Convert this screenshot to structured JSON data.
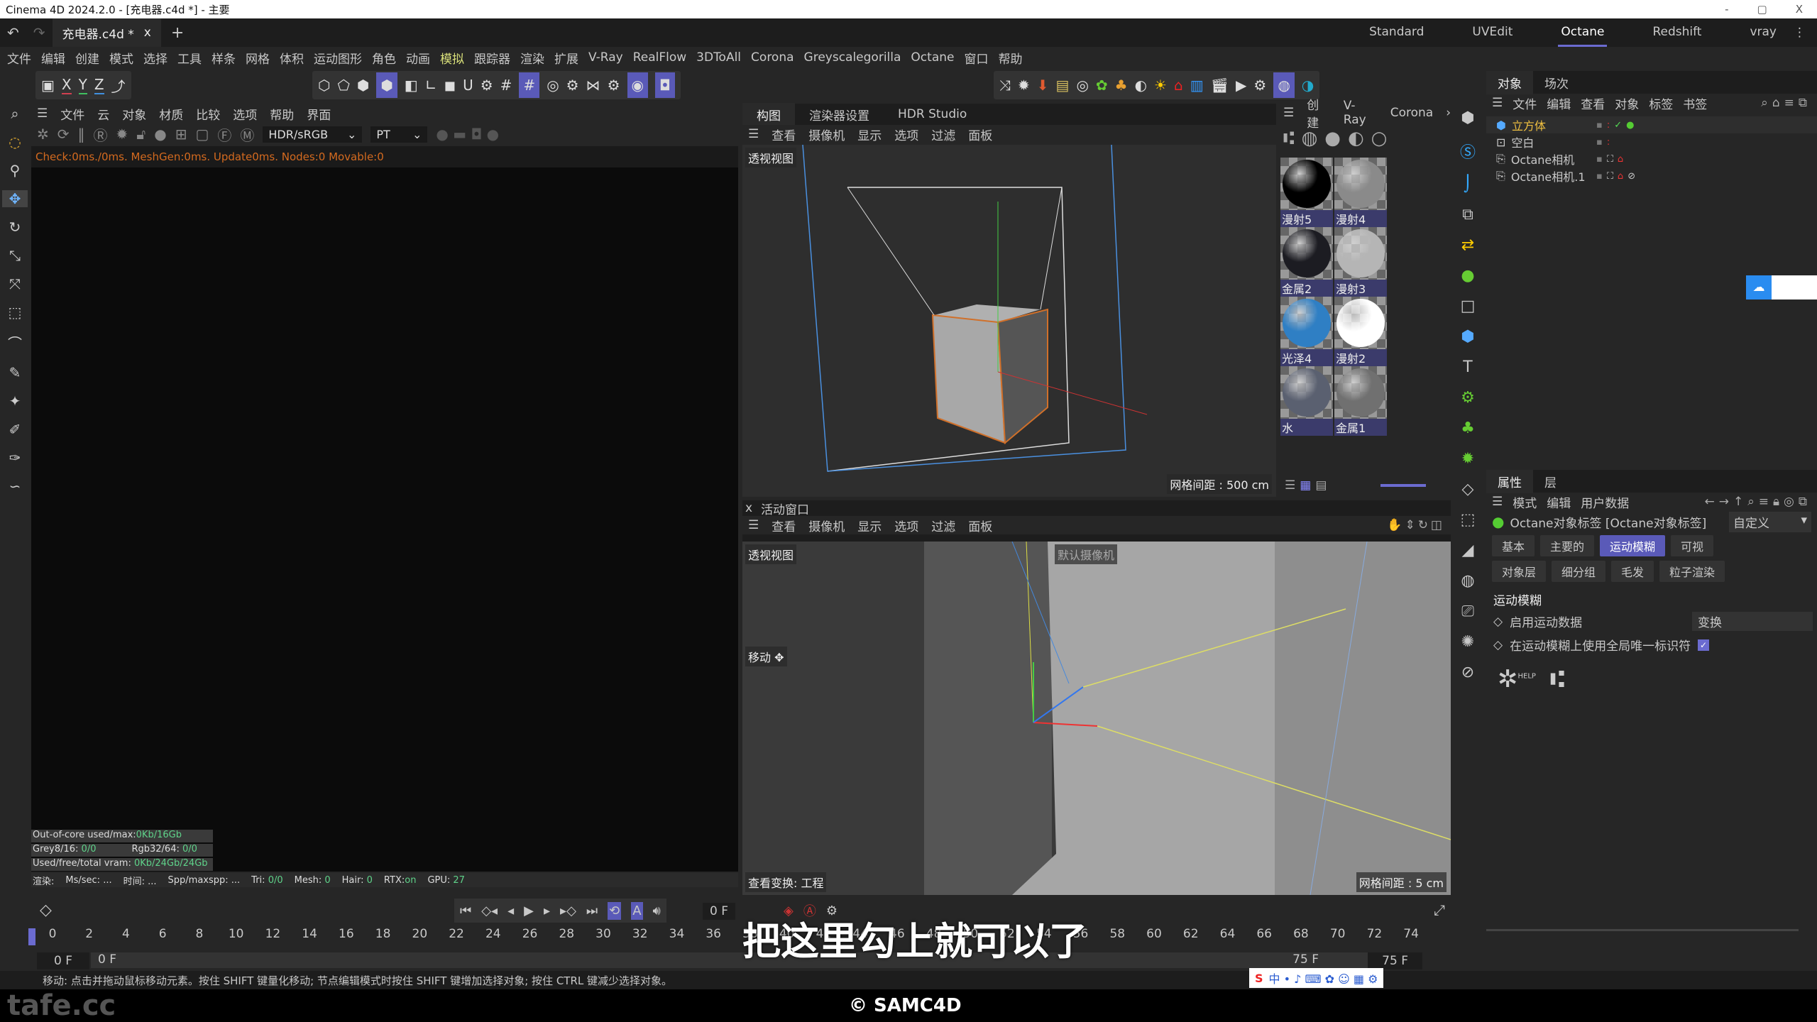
{
  "window": {
    "title": "Cinema 4D 2024.2.0 - [充电器.c4d *] - 主要",
    "min": "-",
    "max": "▢",
    "close": "X"
  },
  "tabs": {
    "doc": "充电器.c4d *",
    "close": "x",
    "add": "+",
    "layouts": [
      "Standard",
      "UVEdit",
      "Octane",
      "Redshift",
      "vray"
    ],
    "active_layout": "Octane"
  },
  "menu": [
    "文件",
    "编辑",
    "创建",
    "模式",
    "选择",
    "工具",
    "样条",
    "网格",
    "体积",
    "运动图形",
    "角色",
    "动画",
    "模拟",
    "跟踪器",
    "渲染",
    "扩展",
    "V-Ray",
    "RealFlow",
    "3DToAll",
    "Corona",
    "Greyscalegorilla",
    "Octane",
    "窗口",
    "帮助"
  ],
  "axes": {
    "x": "X",
    "y": "Y",
    "z": "Z"
  },
  "live": {
    "menu": [
      "文件",
      "云",
      "对象",
      "材质",
      "比较",
      "选项",
      "帮助",
      "界面"
    ],
    "colorspace": "HDR/sRGB",
    "kernel": "PT",
    "check": "Check:0ms./0ms. MeshGen:0ms. Update0ms. Nodes:0 Movable:0",
    "stats": {
      "ooc_label": "Out-of-core used/max:",
      "ooc": "0Kb/16Gb",
      "grey_label": "Grey8/16:",
      "grey": "0/0",
      "rgb_label": "Rgb32/64:",
      "rgb": "0/0",
      "vram_label": "Used/free/total vram:",
      "vram": "0Kb/24Gb/24Gb"
    },
    "render": {
      "label": "渲染:",
      "mssec": "Ms/sec: ...",
      "time": "时间: ...",
      "spp": "Spp/maxspp: ...",
      "tri_label": "Tri:",
      "tri": "0/0",
      "mesh_label": "Mesh:",
      "mesh": "0",
      "hair_label": "Hair:",
      "hair": "0",
      "rtx_label": "RTX:",
      "rtx": "on",
      "gpu_label": "GPU:",
      "gpu": "27"
    }
  },
  "viewport_top": {
    "tabs": [
      "构图",
      "渲染器设置",
      "HDR Studio"
    ],
    "menu": [
      "查看",
      "摄像机",
      "显示",
      "选项",
      "过滤",
      "面板"
    ],
    "label": "透视视图",
    "grid": "网格间距 : 500 cm"
  },
  "viewport_bottom": {
    "title": "活动窗口",
    "close": "x",
    "menu": [
      "查看",
      "摄像机",
      "显示",
      "选项",
      "过滤",
      "面板"
    ],
    "label": "透视视图",
    "camera": "默认摄像机",
    "tool": "移动",
    "transform": "查看变换: 工程",
    "grid": "网格间距 : 5 cm"
  },
  "materials": {
    "menu": [
      "创建",
      "V-Ray",
      "Corona"
    ],
    "items": [
      {
        "name": "漫射5",
        "color": "#000000"
      },
      {
        "name": "漫射4",
        "color": "#8a8a8a"
      },
      {
        "name": "金属2",
        "color": "#1c1c22"
      },
      {
        "name": "漫射3",
        "color": "#b5b5b5"
      },
      {
        "name": "光泽4",
        "color": "#2f7fc4"
      },
      {
        "name": "漫射2",
        "color": "#ffffff"
      },
      {
        "name": "水",
        "color": "#5a6070"
      },
      {
        "name": "金属1",
        "color": "#707070"
      }
    ]
  },
  "objects": {
    "tabs": [
      "对象",
      "场次"
    ],
    "menu": [
      "文件",
      "编辑",
      "查看",
      "对象",
      "标签",
      "书签"
    ],
    "items": [
      {
        "name": "立方体",
        "selected": true
      },
      {
        "name": "空白"
      },
      {
        "name": "Octane相机"
      },
      {
        "name": "Octane相机.1"
      }
    ]
  },
  "attributes": {
    "tabs": [
      "属性",
      "层"
    ],
    "menu": [
      "模式",
      "编辑",
      "用户数据"
    ],
    "title": "Octane对象标签 [Octane对象标签]",
    "preset": "自定义",
    "buttons": [
      "基本",
      "主要的",
      "运动模糊",
      "可视",
      "对象层",
      "细分组",
      "毛发",
      "粒子渲染"
    ],
    "active": "运动模糊",
    "section": "运动模糊",
    "fields": [
      {
        "label": "启用运动数据",
        "value": "变换"
      },
      {
        "label": "在运动模糊上使用全局唯一标识符",
        "checked": true
      }
    ],
    "help": "HELP"
  },
  "timeline": {
    "ticks": [
      0,
      2,
      4,
      6,
      8,
      10,
      12,
      14,
      16,
      18,
      20,
      22,
      24,
      26,
      28,
      30,
      32,
      34,
      36,
      38,
      40,
      42,
      44,
      46,
      48,
      50,
      52,
      54,
      56,
      58,
      60,
      62,
      64,
      66,
      68,
      70,
      72,
      74
    ],
    "current": "0 F",
    "start": "0 F",
    "min": "0 F",
    "end": "75 F",
    "max": "75 F",
    "current_frame": 0
  },
  "status": "移动: 点击并拖动鼠标移动元素。按住 SHIFT 键量化移动; 节点编辑模式时按住 SHIFT 键增加选择对象; 按住 CTRL 键减少选择对象。",
  "subtitle": "把这里勾上就可以了",
  "watermark": "tafe.cc",
  "credit": "© SAMC4D",
  "colors": {
    "accent": "#5a5ab8",
    "selected_object": "#f0c040",
    "check_text": "#d46a1f"
  }
}
